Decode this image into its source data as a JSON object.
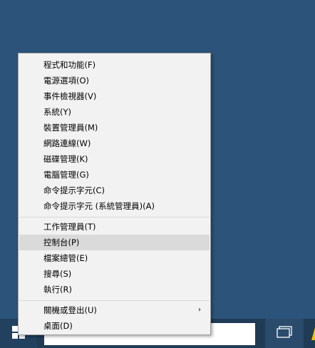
{
  "context_menu": {
    "group1": [
      "程式和功能(F)",
      "電源選項(O)",
      "事件檢視器(V)",
      "系統(Y)",
      "裝置管理員(M)",
      "網路連線(W)",
      "磁碟管理(K)",
      "電腦管理(G)",
      "命令提示字元(C)",
      "命令提示字元 (系統管理員)(A)"
    ],
    "group2": [
      "工作管理員(T)",
      "控制台(P)",
      "檔案總管(E)",
      "搜尋(S)",
      "執行(R)"
    ],
    "group3": [
      "關機或登出(U)",
      "桌面(D)"
    ],
    "highlighted_item": "控制台(P)",
    "submenu_arrow": "›"
  },
  "taskbar": {
    "start_icon": "windows-logo-icon",
    "taskview_icon": "task-view-icon",
    "search_value": ""
  },
  "colors": {
    "desktop": "#2c547a",
    "taskbar": "#1f3b56",
    "menu_bg": "#f2f2f2",
    "highlight": "#dadada"
  }
}
